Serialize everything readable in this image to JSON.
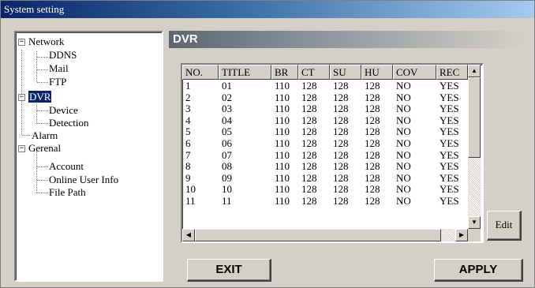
{
  "window": {
    "title": "System setting"
  },
  "tree": {
    "network": "Network",
    "ddns": "DDNS",
    "mail": "Mail",
    "ftp": "FTP",
    "dvr": "DVR",
    "device": "Device",
    "detection": "Detection",
    "alarm": "Alarm",
    "general": "Gerenal",
    "account": "Account",
    "online_user_info": "Online User Info",
    "file_path": "File Path",
    "expand_minus": "−"
  },
  "panel": {
    "title": "DVR"
  },
  "list": {
    "columns": [
      "NO.",
      "TITLE",
      "BR",
      "CT",
      "SU",
      "HU",
      "COV",
      "REC"
    ],
    "rows": [
      [
        "1",
        "01",
        "110",
        "128",
        "128",
        "128",
        "NO",
        "YES"
      ],
      [
        "2",
        "02",
        "110",
        "128",
        "128",
        "128",
        "NO",
        "YES"
      ],
      [
        "3",
        "03",
        "110",
        "128",
        "128",
        "128",
        "NO",
        "YES"
      ],
      [
        "4",
        "04",
        "110",
        "128",
        "128",
        "128",
        "NO",
        "YES"
      ],
      [
        "5",
        "05",
        "110",
        "128",
        "128",
        "128",
        "NO",
        "YES"
      ],
      [
        "6",
        "06",
        "110",
        "128",
        "128",
        "128",
        "NO",
        "YES"
      ],
      [
        "7",
        "07",
        "110",
        "128",
        "128",
        "128",
        "NO",
        "YES"
      ],
      [
        "8",
        "08",
        "110",
        "128",
        "128",
        "128",
        "NO",
        "YES"
      ],
      [
        "9",
        "09",
        "110",
        "128",
        "128",
        "128",
        "NO",
        "YES"
      ],
      [
        "10",
        "10",
        "110",
        "128",
        "128",
        "128",
        "NO",
        "YES"
      ],
      [
        "11",
        "11",
        "110",
        "128",
        "128",
        "128",
        "NO",
        "YES"
      ]
    ]
  },
  "icons": {
    "scroll_up": "▲",
    "scroll_down": "▼",
    "scroll_left": "◀",
    "scroll_right": "▶"
  },
  "buttons": {
    "edit": "Edit",
    "exit": "EXIT",
    "apply": "APPLY"
  },
  "colors": {
    "titlebar": "#0a246a",
    "selection": "#0a246a",
    "face": "#d4d0c8"
  }
}
